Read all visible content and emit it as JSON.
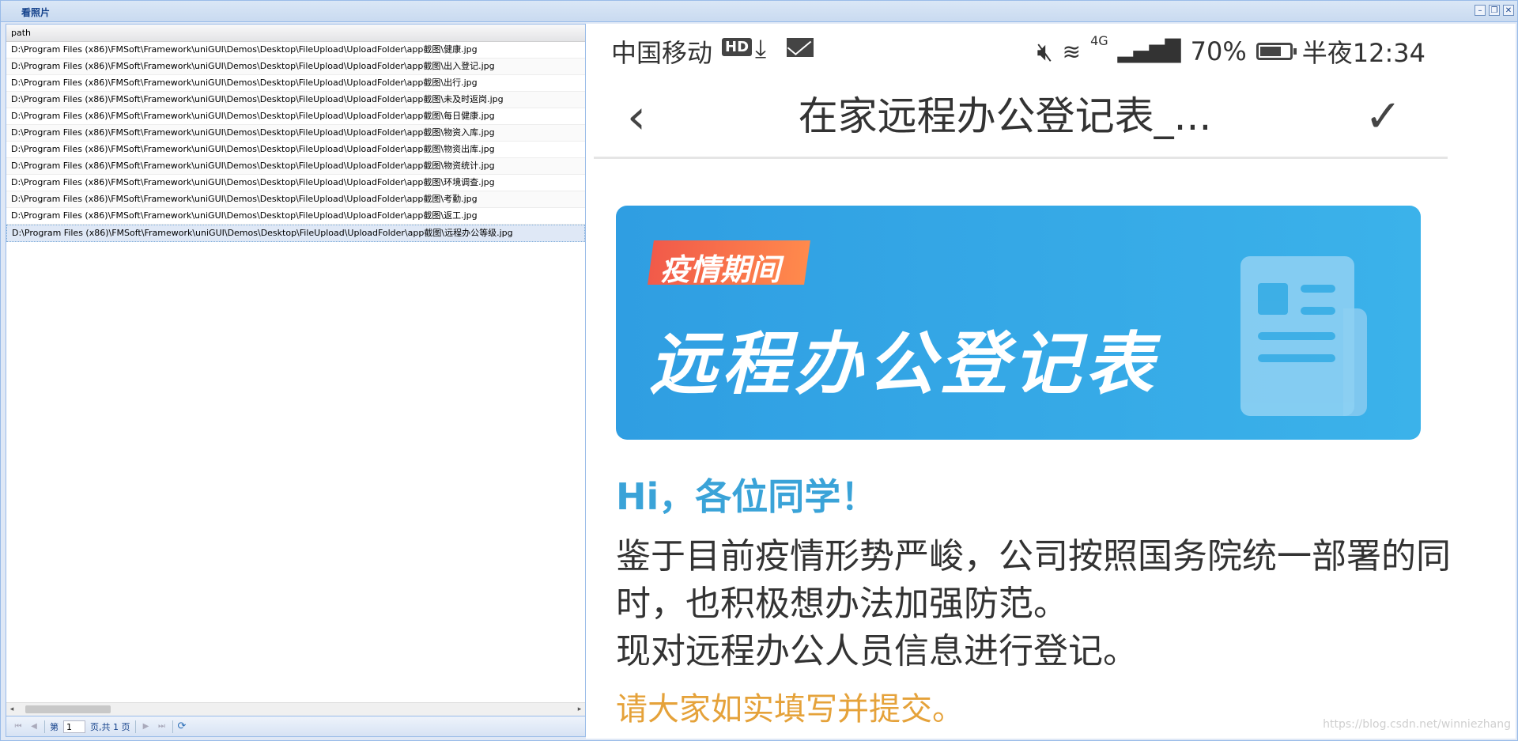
{
  "window": {
    "title": "看照片",
    "controls": [
      "minimize",
      "restore",
      "close"
    ]
  },
  "grid": {
    "column": "path",
    "rows": [
      "D:\\Program Files (x86)\\FMSoft\\Framework\\uniGUI\\Demos\\Desktop\\FileUpload\\UploadFolder\\app截图\\健康.jpg",
      "D:\\Program Files (x86)\\FMSoft\\Framework\\uniGUI\\Demos\\Desktop\\FileUpload\\UploadFolder\\app截图\\出入登记.jpg",
      "D:\\Program Files (x86)\\FMSoft\\Framework\\uniGUI\\Demos\\Desktop\\FileUpload\\UploadFolder\\app截图\\出行.jpg",
      "D:\\Program Files (x86)\\FMSoft\\Framework\\uniGUI\\Demos\\Desktop\\FileUpload\\UploadFolder\\app截图\\未及时返岗.jpg",
      "D:\\Program Files (x86)\\FMSoft\\Framework\\uniGUI\\Demos\\Desktop\\FileUpload\\UploadFolder\\app截图\\每日健康.jpg",
      "D:\\Program Files (x86)\\FMSoft\\Framework\\uniGUI\\Demos\\Desktop\\FileUpload\\UploadFolder\\app截图\\物资入库.jpg",
      "D:\\Program Files (x86)\\FMSoft\\Framework\\uniGUI\\Demos\\Desktop\\FileUpload\\UploadFolder\\app截图\\物资出库.jpg",
      "D:\\Program Files (x86)\\FMSoft\\Framework\\uniGUI\\Demos\\Desktop\\FileUpload\\UploadFolder\\app截图\\物资统计.jpg",
      "D:\\Program Files (x86)\\FMSoft\\Framework\\uniGUI\\Demos\\Desktop\\FileUpload\\UploadFolder\\app截图\\环境调查.jpg",
      "D:\\Program Files (x86)\\FMSoft\\Framework\\uniGUI\\Demos\\Desktop\\FileUpload\\UploadFolder\\app截图\\考勤.jpg",
      "D:\\Program Files (x86)\\FMSoft\\Framework\\uniGUI\\Demos\\Desktop\\FileUpload\\UploadFolder\\app截图\\返工.jpg",
      "D:\\Program Files (x86)\\FMSoft\\Framework\\uniGUI\\Demos\\Desktop\\FileUpload\\UploadFolder\\app截图\\远程办公等级.jpg"
    ],
    "selected_index": 11
  },
  "pager": {
    "page_prefix": "第",
    "page_value": "1",
    "page_suffix": "页,共 1 页"
  },
  "phone": {
    "carrier": "中国移动",
    "hd": "HD",
    "lte": "4G",
    "battery": "70%",
    "time": "半夜12:34",
    "nav_title": "在家远程办公登记表_...",
    "banner_tag": "疫情期间",
    "banner_title": "远程办公登记表",
    "greeting": "Hi，各位同学！",
    "para1": "鉴于目前疫情形势严峻，公司按照国务院统一部署的同时，也积极想办法加强防范。",
    "para2": "现对远程办公人员信息进行登记。",
    "para3": "请大家如实填写并提交。"
  },
  "watermark": "https://blog.csdn.net/winniezhang",
  "colors": {
    "accent": "#15428b",
    "banner": "#2f9ee2",
    "greeting": "#3aa3d8",
    "orange": "#e5a23a"
  }
}
